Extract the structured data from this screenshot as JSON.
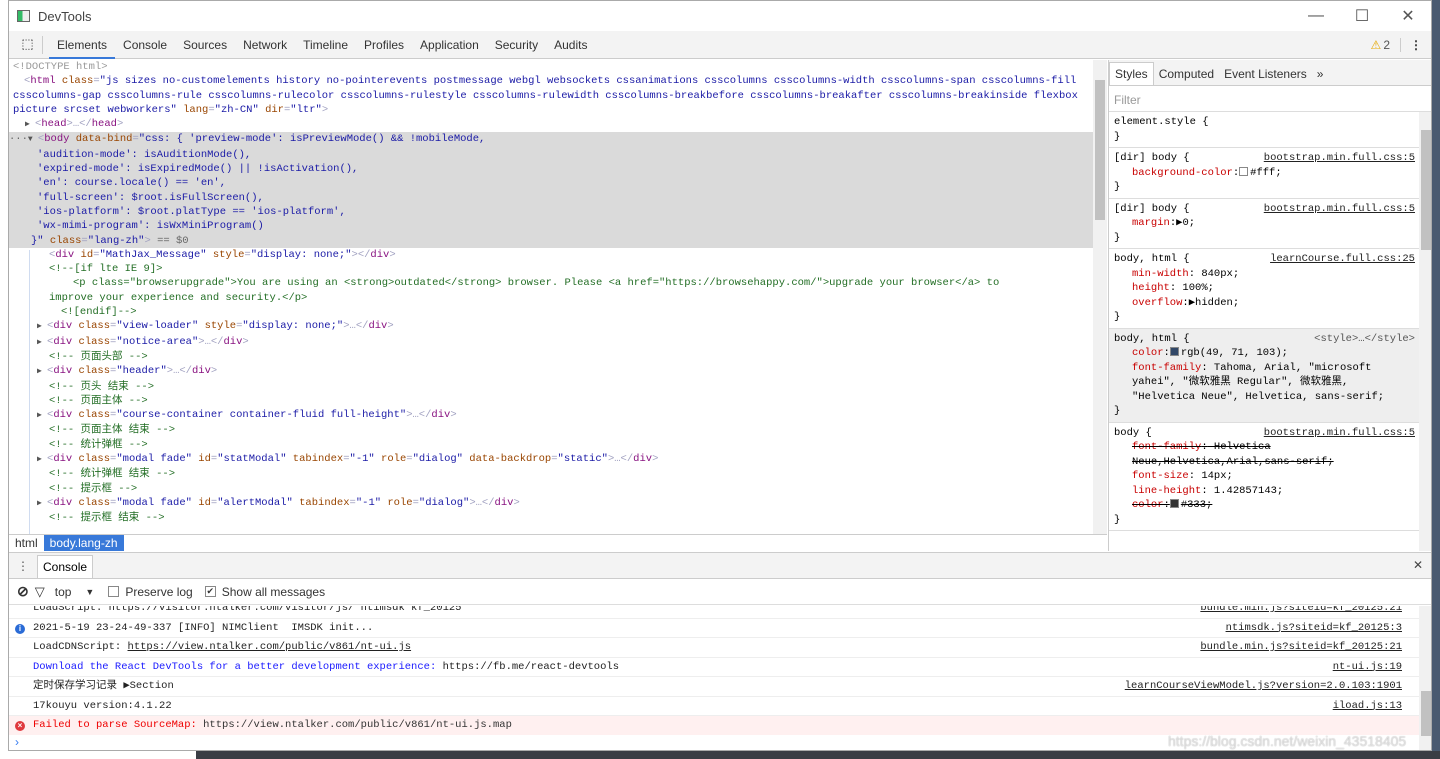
{
  "window": {
    "title": "DevTools",
    "minimize": "—",
    "maximize": "☐",
    "close": "✕"
  },
  "toolbar": {
    "tabs": [
      "Elements",
      "Console",
      "Sources",
      "Network",
      "Timeline",
      "Profiles",
      "Application",
      "Security",
      "Audits"
    ],
    "active": "Elements",
    "warning_icon": "⚠",
    "warning_count": "2",
    "menu": "⋮"
  },
  "dom": {
    "lines": [
      {
        "indent": 0,
        "arrow": "",
        "tokens": [
          [
            "doc",
            "<!DOCTYPE html>"
          ]
        ]
      },
      {
        "indent": 0,
        "arrow": "",
        "wrap": true,
        "tokens": [
          [
            "br",
            "<"
          ],
          [
            "tag",
            "html"
          ],
          [
            "an",
            " class"
          ],
          [
            "br",
            "="
          ],
          [
            "av",
            "\"js sizes no-customelements history no-pointerevents postmessage webgl websockets cssanimations csscolumns csscolumns-width csscolumns-span csscolumns-fill csscolumns-gap csscolumns-rule csscolumns-rulecolor csscolumns-rulestyle csscolumns-rulewidth csscolumns-breakbefore csscolumns-breakafter csscolumns-breakinside flexbox picture srcset webworkers\""
          ],
          [
            "an",
            " lang"
          ],
          [
            "br",
            "="
          ],
          [
            "av",
            "\"zh-CN\""
          ],
          [
            "an",
            " dir"
          ],
          [
            "br",
            "="
          ],
          [
            "av",
            "\"ltr\""
          ],
          [
            "br",
            ">"
          ]
        ]
      },
      {
        "indent": 1,
        "arrow": "▶",
        "tokens": [
          [
            "br",
            "<"
          ],
          [
            "tag",
            "head"
          ],
          [
            "br",
            ">…</"
          ],
          [
            "tag",
            "head"
          ],
          [
            "br",
            ">"
          ]
        ]
      },
      {
        "indent": 1,
        "arrow": "▼",
        "sel": true,
        "prefix": "···",
        "tokens": [
          [
            "br",
            "<"
          ],
          [
            "tag",
            "body"
          ],
          [
            "an",
            " data-bind"
          ],
          [
            "br",
            "="
          ],
          [
            "av",
            "\"css: { 'preview-mode': isPreviewMode() && !mobileMode,"
          ]
        ]
      },
      {
        "indent": 2,
        "sel": true,
        "tokens": [
          [
            "av",
            "'audition-mode': isAuditionMode(),"
          ]
        ]
      },
      {
        "indent": 2,
        "sel": true,
        "tokens": [
          [
            "av",
            "'expired-mode': isExpiredMode() || !isActivation(),"
          ]
        ]
      },
      {
        "indent": 2,
        "sel": true,
        "tokens": [
          [
            "av",
            "'en': course.locale() == 'en',"
          ]
        ]
      },
      {
        "indent": 2,
        "sel": true,
        "tokens": [
          [
            "av",
            "'full-screen': $root.isFullScreen(),"
          ]
        ]
      },
      {
        "indent": 2,
        "sel": true,
        "tokens": [
          [
            "av",
            "'ios-platform': $root.platType == 'ios-platform',"
          ]
        ]
      },
      {
        "indent": 2,
        "sel": true,
        "tokens": [
          [
            "av",
            "'wx-mimi-program': isWxMiniProgram()"
          ]
        ]
      },
      {
        "indent": 1.5,
        "sel": true,
        "tokens": [
          [
            "av",
            "}\""
          ],
          [
            "an",
            " class"
          ],
          [
            "br",
            "="
          ],
          [
            "av",
            "\"lang-zh\""
          ],
          [
            "br",
            ">"
          ],
          [
            "gr",
            " == $0"
          ]
        ]
      },
      {
        "indent": 3,
        "tokens": [
          [
            "br",
            "<"
          ],
          [
            "tag",
            "div"
          ],
          [
            "an",
            " id"
          ],
          [
            "br",
            "="
          ],
          [
            "av",
            "\"MathJax_Message\""
          ],
          [
            "an",
            " style"
          ],
          [
            "br",
            "="
          ],
          [
            "av",
            "\"display: none;\""
          ],
          [
            "br",
            "></"
          ],
          [
            "tag",
            "div"
          ],
          [
            "br",
            ">"
          ]
        ]
      },
      {
        "indent": 3,
        "tokens": [
          [
            "cm",
            "<!--[if lte IE 9]>"
          ]
        ]
      },
      {
        "indent": 5,
        "tokens": [
          [
            "cm",
            "<p class=\"browserupgrade\">You are using an <strong>outdated</strong> browser. Please <a href=\"https://browsehappy.com/\">upgrade your browser</a> to"
          ]
        ]
      },
      {
        "indent": 3,
        "tokens": [
          [
            "cm",
            "improve your experience and security.</p>"
          ]
        ]
      },
      {
        "indent": 4,
        "tokens": [
          [
            "cm",
            "<![endif]-->"
          ]
        ]
      },
      {
        "indent": 2,
        "arrow": "▶",
        "tokens": [
          [
            "br",
            "<"
          ],
          [
            "tag",
            "div"
          ],
          [
            "an",
            " class"
          ],
          [
            "br",
            "="
          ],
          [
            "av",
            "\"view-loader\""
          ],
          [
            "an",
            " style"
          ],
          [
            "br",
            "="
          ],
          [
            "av",
            "\"display: none;\""
          ],
          [
            "br",
            ">…</"
          ],
          [
            "tag",
            "div"
          ],
          [
            "br",
            ">"
          ]
        ]
      },
      {
        "indent": 2,
        "arrow": "▶",
        "tokens": [
          [
            "br",
            "<"
          ],
          [
            "tag",
            "div"
          ],
          [
            "an",
            " class"
          ],
          [
            "br",
            "="
          ],
          [
            "av",
            "\"notice-area\""
          ],
          [
            "br",
            ">…</"
          ],
          [
            "tag",
            "div"
          ],
          [
            "br",
            ">"
          ]
        ]
      },
      {
        "indent": 3,
        "tokens": [
          [
            "cm",
            "<!-- 页面头部 -->"
          ]
        ]
      },
      {
        "indent": 2,
        "arrow": "▶",
        "tokens": [
          [
            "br",
            "<"
          ],
          [
            "tag",
            "div"
          ],
          [
            "an",
            " class"
          ],
          [
            "br",
            "="
          ],
          [
            "av",
            "\"header\""
          ],
          [
            "br",
            ">…</"
          ],
          [
            "tag",
            "div"
          ],
          [
            "br",
            ">"
          ]
        ]
      },
      {
        "indent": 3,
        "tokens": [
          [
            "cm",
            "<!-- 页头 结束 -->"
          ]
        ]
      },
      {
        "indent": 3,
        "tokens": [
          [
            "cm",
            "<!-- 页面主体 -->"
          ]
        ]
      },
      {
        "indent": 2,
        "arrow": "▶",
        "tokens": [
          [
            "br",
            "<"
          ],
          [
            "tag",
            "div"
          ],
          [
            "an",
            " class"
          ],
          [
            "br",
            "="
          ],
          [
            "av",
            "\"course-container container-fluid full-height\""
          ],
          [
            "br",
            ">…</"
          ],
          [
            "tag",
            "div"
          ],
          [
            "br",
            ">"
          ]
        ]
      },
      {
        "indent": 3,
        "tokens": [
          [
            "cm",
            "<!-- 页面主体 结束 -->"
          ]
        ]
      },
      {
        "indent": 3,
        "tokens": [
          [
            "cm",
            "<!-- 统计弹框 -->"
          ]
        ]
      },
      {
        "indent": 2,
        "arrow": "▶",
        "tokens": [
          [
            "br",
            "<"
          ],
          [
            "tag",
            "div"
          ],
          [
            "an",
            " class"
          ],
          [
            "br",
            "="
          ],
          [
            "av",
            "\"modal fade\""
          ],
          [
            "an",
            " id"
          ],
          [
            "br",
            "="
          ],
          [
            "av",
            "\"statModal\""
          ],
          [
            "an",
            " tabindex"
          ],
          [
            "br",
            "="
          ],
          [
            "av",
            "\"-1\""
          ],
          [
            "an",
            " role"
          ],
          [
            "br",
            "="
          ],
          [
            "av",
            "\"dialog\""
          ],
          [
            "an",
            " data-backdrop"
          ],
          [
            "br",
            "="
          ],
          [
            "av",
            "\"static\""
          ],
          [
            "br",
            ">…</"
          ],
          [
            "tag",
            "div"
          ],
          [
            "br",
            ">"
          ]
        ]
      },
      {
        "indent": 3,
        "tokens": [
          [
            "cm",
            "<!-- 统计弹框 结束 -->"
          ]
        ]
      },
      {
        "indent": 3,
        "tokens": [
          [
            "cm",
            "<!-- 提示框 -->"
          ]
        ]
      },
      {
        "indent": 2,
        "arrow": "▶",
        "tokens": [
          [
            "br",
            "<"
          ],
          [
            "tag",
            "div"
          ],
          [
            "an",
            " class"
          ],
          [
            "br",
            "="
          ],
          [
            "av",
            "\"modal fade\""
          ],
          [
            "an",
            " id"
          ],
          [
            "br",
            "="
          ],
          [
            "av",
            "\"alertModal\""
          ],
          [
            "an",
            " tabindex"
          ],
          [
            "br",
            "="
          ],
          [
            "av",
            "\"-1\""
          ],
          [
            "an",
            " role"
          ],
          [
            "br",
            "="
          ],
          [
            "av",
            "\"dialog\""
          ],
          [
            "br",
            ">…</"
          ],
          [
            "tag",
            "div"
          ],
          [
            "br",
            ">"
          ]
        ]
      },
      {
        "indent": 3,
        "tokens": [
          [
            "cm",
            "<!-- 提示框 结束 -->"
          ]
        ]
      }
    ]
  },
  "breadcrumb": {
    "items": [
      "html",
      "body.lang-zh"
    ]
  },
  "styles": {
    "tabs": [
      "Styles",
      "Computed",
      "Event Listeners",
      "»"
    ],
    "filter_placeholder": "Filter",
    "rules": [
      {
        "selector": "element.style {",
        "source": "",
        "props": []
      },
      {
        "selector": "[dir] body {",
        "source": "bootstrap.min.full.css:5",
        "props": [
          {
            "name": "background-color",
            "value": "#fff;",
            "swatch": "#ffffff"
          }
        ]
      },
      {
        "selector": "[dir] body {",
        "source": "bootstrap.min.full.css:5",
        "props": [
          {
            "name": "margin",
            "value": "▶0;"
          }
        ]
      },
      {
        "selector": "body, html {",
        "source": "learnCourse.full.css:25",
        "props": [
          {
            "name": "min-width",
            "value": " 840px;"
          },
          {
            "name": "height",
            "value": " 100%;"
          },
          {
            "name": "overflow",
            "value": "▶hidden;"
          }
        ]
      },
      {
        "selector": "body, html {",
        "source": "<style>…</style>",
        "grey": true,
        "plain": true,
        "props": [
          {
            "name": "color",
            "value": "rgb(49, 71, 103);",
            "swatch": "#314767"
          },
          {
            "name": "font-family",
            "value": " Tahoma, Arial, \"microsoft yahei\", \"微软雅黑 Regular\", 微软雅黑, \"Helvetica Neue\", Helvetica, sans-serif;"
          }
        ]
      },
      {
        "selector": "body {",
        "source": "bootstrap.min.full.css:5",
        "props": [
          {
            "name": "font-family",
            "value": " Helvetica Neue,Helvetica,Arial,sans-serif;",
            "struck": true
          },
          {
            "name": "font-size",
            "value": " 14px;"
          },
          {
            "name": "line-height",
            "value": " 1.42857143;"
          },
          {
            "name": "color",
            "value": "#333;",
            "swatch": "#333333",
            "struck": true
          }
        ]
      }
    ]
  },
  "drawer": {
    "tab": "Console",
    "close": "✕",
    "context": "top",
    "preserve_log": {
      "label": "Preserve log",
      "checked": false
    },
    "show_all": {
      "label": "Show all messages",
      "checked": true
    },
    "messages": [
      {
        "level": "log",
        "parts": [
          [
            "t",
            "LoadScript: https://visitor.ntalker.com/visitor/js/ ntimsdk kf_20125"
          ]
        ],
        "source": "bundle.min.js?siteid=kf_20125:21"
      },
      {
        "level": "info",
        "parts": [
          [
            "t",
            "2021-5-19 23-24-49-337 [INFO] NIMClient  IMSDK init..."
          ]
        ],
        "source": "ntimsdk.js?siteid=kf_20125:3"
      },
      {
        "level": "log",
        "parts": [
          [
            "t",
            "LoadCDNScript: "
          ],
          [
            "lnk",
            "https://view.ntalker.com/public/v861/nt-ui.js"
          ]
        ],
        "source": "bundle.min.js?siteid=kf_20125:21"
      },
      {
        "level": "log",
        "parts": [
          [
            "blue",
            "Download the React DevTools for a better development experience:"
          ],
          [
            "t",
            " https://fb.me/react-devtools"
          ]
        ],
        "source": "nt-ui.js:19"
      },
      {
        "level": "log",
        "parts": [
          [
            "t",
            "定时保存学习记录 "
          ],
          [
            "t",
            "▶Section"
          ]
        ],
        "source": "learnCourseViewModel.js?version=2.0.103:1901"
      },
      {
        "level": "log",
        "parts": [
          [
            "t",
            "17kouyu version:4.1.22"
          ]
        ],
        "source": "iload.js:13"
      },
      {
        "level": "error",
        "parts": [
          [
            "t",
            "Failed to parse SourceMap:"
          ],
          [
            "dk",
            " https://view.ntalker.com/public/v861/nt-ui.js.map"
          ]
        ],
        "source": ""
      }
    ],
    "prompt": "›"
  },
  "watermark": "https://blog.csdn.net/weixin_43518405",
  "colors": {
    "accent": "#3879d9",
    "tag": "#881280",
    "attr_name": "#994500",
    "attr_value": "#1a1aa6",
    "comment": "#236e25",
    "error_bg": "#fff0f0",
    "prop_name": "#c80000",
    "warning": "#e6a800"
  }
}
